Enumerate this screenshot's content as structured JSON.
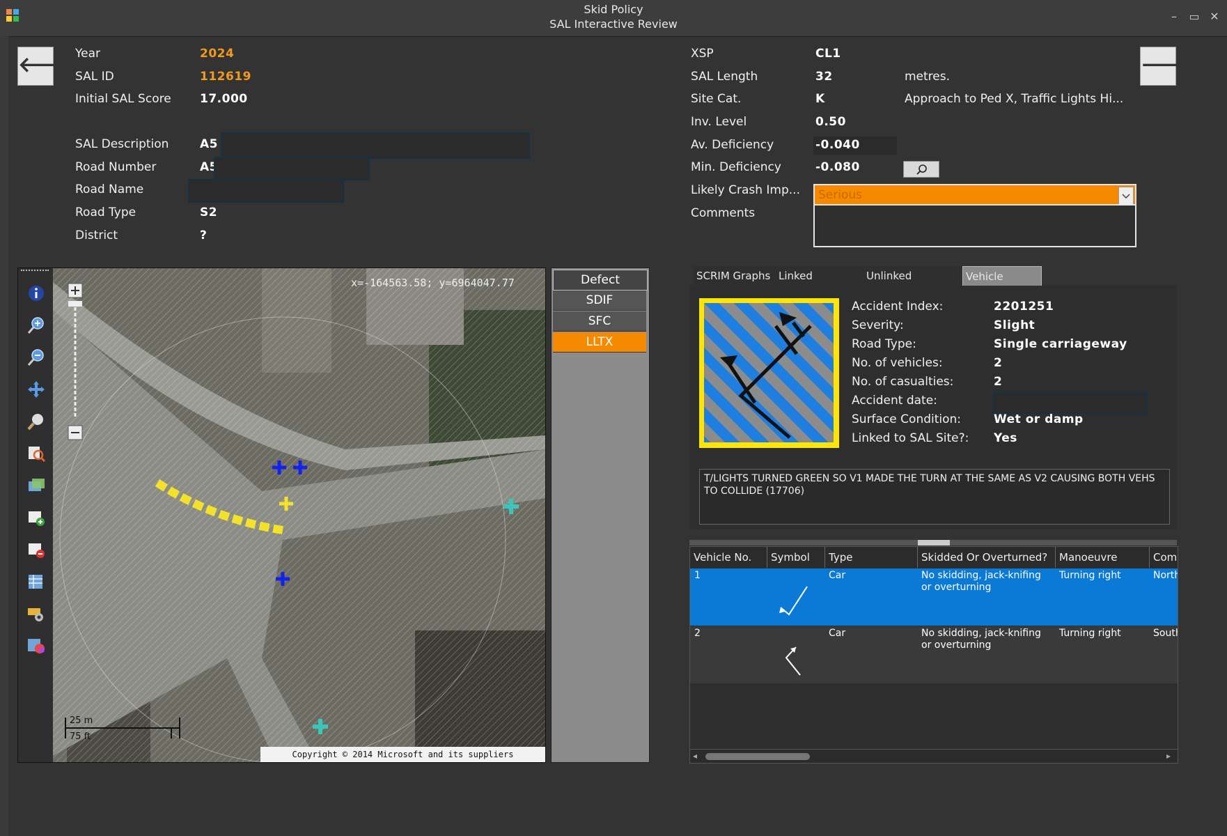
{
  "window": {
    "title": "Skid Policy",
    "subtitle": "SAL Interactive Review"
  },
  "nav": {
    "prev_icon": "arrow-left",
    "next_icon": "arrow-right",
    "prev_glyph": "🡐",
    "next_glyph": "🡒"
  },
  "left_info": {
    "year_label": "Year",
    "year_value": "2024",
    "salid_label": "SAL ID",
    "salid_value": "112619",
    "score_label": "Initial SAL Score",
    "score_value": "17.000",
    "desc_label": "SAL Description",
    "desc_value": "A5",
    "roadnum_label": "Road Number",
    "roadnum_value": "A5",
    "roadname_label": "Road Name",
    "roadname_value": "",
    "roadtype_label": "Road Type",
    "roadtype_value": "S2",
    "district_label": "District",
    "district_value": "?"
  },
  "right_info": {
    "xsp_label": "XSP",
    "xsp_value": "CL1",
    "length_label": "SAL Length",
    "length_value": "32",
    "length_unit": "metres.",
    "sitecat_label": "Site Cat.",
    "sitecat_value": "K",
    "sitecat_desc": "Approach to Ped X, Traffic Lights  Hi...",
    "inv_label": "Inv. Level",
    "inv_value": "0.50",
    "avdef_label": "Av. Deficiency",
    "avdef_value": "-0.040",
    "mindef_label": "Min. Deficiency",
    "mindef_value": "-0.080",
    "crash_label": "Likely Crash Imp...",
    "crash_value": "Serious",
    "comments_label": "Comments",
    "comments_value": ""
  },
  "map": {
    "coords": "x=-164563.58; y=6964047.77",
    "copyright": "Copyright © 2014 Microsoft and its suppliers",
    "scale_m": "25 m",
    "scale_ft": "75 ft",
    "tools": [
      "info-icon",
      "zoom-in-icon",
      "zoom-out-icon",
      "pan-icon",
      "zoom-window-icon",
      "find-icon",
      "layers-icon",
      "add-layer-icon",
      "remove-layer-icon",
      "table-icon",
      "settings-icon",
      "theme-icon"
    ]
  },
  "layers": {
    "items": [
      "Defect",
      "SDIF",
      "SFC",
      "LLTX"
    ],
    "selected": "LLTX"
  },
  "tabs": [
    "SCRIM Graphs",
    "Linked Accidents",
    "Unlinked Accidents",
    "Vehicle Details"
  ],
  "active_tab": "Vehicle Details",
  "accident": {
    "index_label": "Accident Index:",
    "index_value": "2201251",
    "severity_label": "Severity:",
    "severity_value": "Slight",
    "roadtype_label": "Road Type:",
    "roadtype_value": "Single carriageway",
    "vehicles_label": "No. of vehicles:",
    "vehicles_value": "2",
    "casualties_label": "No. of casualties:",
    "casualties_value": "2",
    "date_label": "Accident date:",
    "date_value": "",
    "surface_label": "Surface Condition:",
    "surface_value": "Wet or damp",
    "linked_label": "Linked to SAL Site?:",
    "linked_value": "Yes",
    "narrative": "T/LIGHTS TURNED GREEN SO V1 MADE THE TURN AT THE SAME AS V2 CAUSING BOTH VEHS TO COLLIDE (17706)"
  },
  "vehicle_grid": {
    "headers": [
      "Vehicle No.",
      "Symbol",
      "Type",
      "Skidded Or Overturned?",
      "Manoeuvre",
      "Comi"
    ],
    "rows": [
      {
        "no": "1",
        "type": "Car",
        "skid": "No skidding, jack-knifing or overturning",
        "manoeuvre": "Turning right",
        "dir": "North",
        "selected": true
      },
      {
        "no": "2",
        "type": "Car",
        "skid": "No skidding, jack-knifing or overturning",
        "manoeuvre": "Turning right",
        "dir": "South",
        "selected": false
      }
    ]
  },
  "colors": {
    "accent_orange": "#f29b1a",
    "select_blue": "#0a7ad6",
    "background": "#333333"
  }
}
